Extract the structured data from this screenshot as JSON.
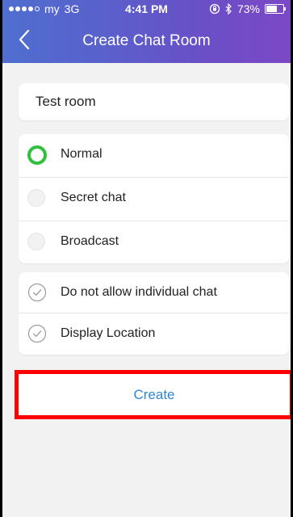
{
  "status_bar": {
    "carrier": "my",
    "network": "3G",
    "time": "4:41 PM",
    "battery": "73%",
    "battery_level": 0.73
  },
  "nav": {
    "title": "Create Chat Room",
    "back_icon": "chevron-left-icon"
  },
  "room_name": "Test room",
  "room_types": [
    {
      "label": "Normal",
      "selected": true
    },
    {
      "label": "Secret chat",
      "selected": false
    },
    {
      "label": "Broadcast",
      "selected": false
    }
  ],
  "options": [
    {
      "label": "Do not allow individual chat"
    },
    {
      "label": "Display Location"
    }
  ],
  "create_label": "Create",
  "colors": {
    "accent_green": "#2fc13e",
    "button_text_blue": "#2e86d6",
    "highlight_red": "#ff0000"
  }
}
